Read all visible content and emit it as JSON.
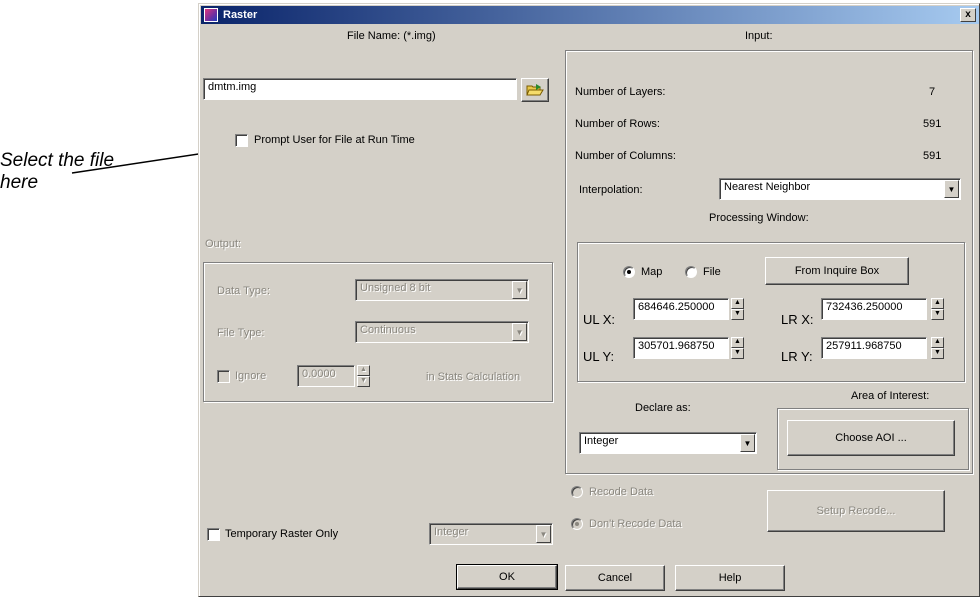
{
  "annotation": {
    "line1": "Select the file",
    "line2": "here"
  },
  "window": {
    "title": "Raster",
    "close_label": "x"
  },
  "file": {
    "label": "File Name: (*.img)",
    "value": "dmtm.img",
    "prompt_label": "Prompt User for File at Run Time",
    "prompt_checked": false
  },
  "output": {
    "label": "Output:",
    "data_type_label": "Data Type:",
    "data_type_value": "Unsigned 8 bit",
    "file_type_label": "File Type:",
    "file_type_value": "Continuous",
    "ignore_label": "Ignore",
    "ignore_value": "0.0000",
    "stats_label": "in Stats Calculation",
    "temporary_label": "Temporary Raster Only",
    "temporary_type_value": "Integer"
  },
  "input": {
    "label": "Input:",
    "layers_label": "Number of Layers:",
    "layers_value": "7",
    "rows_label": "Number of Rows:",
    "rows_value": "591",
    "columns_label": "Number of Columns:",
    "columns_value": "591",
    "interpolation_label": "Interpolation:",
    "interpolation_value": "Nearest Neighbor"
  },
  "processing": {
    "label": "Processing Window:",
    "map_label": "Map",
    "file_label": "File",
    "selected": "Map",
    "inquire_button": "From Inquire Box",
    "ulx_label": "UL X:",
    "ulx_value": "684646.250000",
    "lrx_label": "LR X:",
    "lrx_value": "732436.250000",
    "uly_label": "UL Y:",
    "uly_value": "305701.968750",
    "lry_label": "LR Y:",
    "lry_value": "257911.968750"
  },
  "declare": {
    "label": "Declare as:",
    "value": "Integer"
  },
  "aoi": {
    "label": "Area of Interest:",
    "button": "Choose AOI ..."
  },
  "recode": {
    "recode_label": "Recode Data",
    "dont_recode_label": "Don't Recode Data",
    "setup_button": "Setup Recode..."
  },
  "buttons": {
    "ok": "OK",
    "cancel": "Cancel",
    "help": "Help"
  }
}
